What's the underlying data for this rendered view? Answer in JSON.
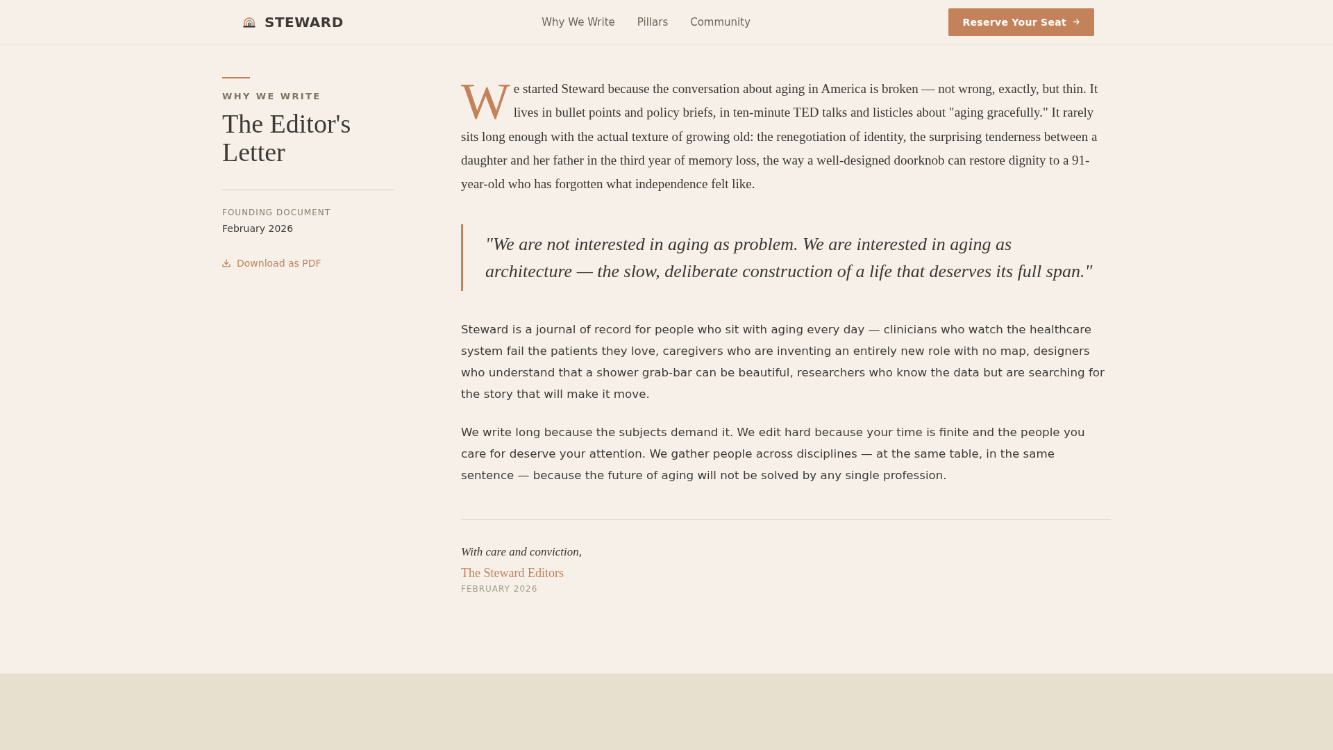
{
  "header": {
    "brand": "STEWARD",
    "nav": [
      {
        "label": "Why We Write"
      },
      {
        "label": "Pillars"
      },
      {
        "label": "Community"
      }
    ],
    "cta": "Reserve Your Seat"
  },
  "sidebar": {
    "eyebrow": "WHY WE WRITE",
    "title": "The Editor's Letter",
    "meta_label": "FOUNDING DOCUMENT",
    "meta_value": "February 2026",
    "download": "Download as PDF"
  },
  "letter": {
    "intro": "We started Steward because the conversation about aging in America is broken — not wrong, exactly, but thin. It lives in bullet points and policy briefs, in ten-minute TED talks and listicles about \"aging gracefully.\" It rarely sits long enough with the actual texture of growing old: the renegotiation of identity, the surprising tenderness between a daughter and her father in the third year of memory loss, the way a well-designed doorknob can restore dignity to a 91-year-old who has forgotten what independence felt like.",
    "pull_quote": "\"We are not interested in aging as problem. We are interested in aging as architecture — the slow, deliberate construction of a life that deserves its full span.\"",
    "paragraphs": [
      "Steward is a journal of record for people who sit with aging every day — clinicians who watch the healthcare system fail the patients they love, caregivers who are inventing an entirely new role with no map, designers who understand that a shower grab-bar can be beautiful, researchers who know the data but are searching for the story that will make it move.",
      "We write long because the subjects demand it. We edit hard because your time is finite and the people you care for deserve your attention. We gather people across disciplines — at the same table, in the same sentence — because the future of aging will not be solved by any single profession."
    ],
    "closing": "With care and conviction,",
    "signature": "The Steward Editors",
    "date": "FEBRUARY 2026"
  }
}
